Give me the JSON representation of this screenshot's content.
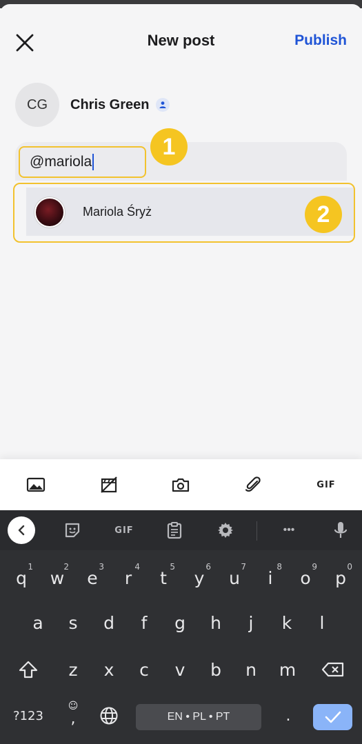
{
  "header": {
    "title": "New post",
    "publish_label": "Publish"
  },
  "author": {
    "initials": "CG",
    "name": "Chris Green"
  },
  "mention": {
    "text": "@mariola"
  },
  "suggestions": [
    {
      "name": "Mariola Śryż"
    }
  ],
  "callouts": {
    "first": "1",
    "second": "2"
  },
  "toolbar": {
    "gif_label": "GIF"
  },
  "keyboard": {
    "suggestion_bar": {
      "gif_label": "GIF",
      "more_label": "•••"
    },
    "row1": [
      {
        "k": "q",
        "h": "1"
      },
      {
        "k": "w",
        "h": "2"
      },
      {
        "k": "e",
        "h": "3"
      },
      {
        "k": "r",
        "h": "4"
      },
      {
        "k": "t",
        "h": "5"
      },
      {
        "k": "y",
        "h": "6"
      },
      {
        "k": "u",
        "h": "7"
      },
      {
        "k": "i",
        "h": "8"
      },
      {
        "k": "o",
        "h": "9"
      },
      {
        "k": "p",
        "h": "0"
      }
    ],
    "row2": [
      "a",
      "s",
      "d",
      "f",
      "g",
      "h",
      "j",
      "k",
      "l"
    ],
    "row3": [
      "z",
      "x",
      "c",
      "v",
      "b",
      "n",
      "m"
    ],
    "symbols_label": "?123",
    "comma": ",",
    "space_label": "EN • PL • PT",
    "period": "."
  },
  "colors": {
    "accent": "#1f54d6",
    "callout": "#f5c521",
    "enter": "#8ab4f8"
  }
}
